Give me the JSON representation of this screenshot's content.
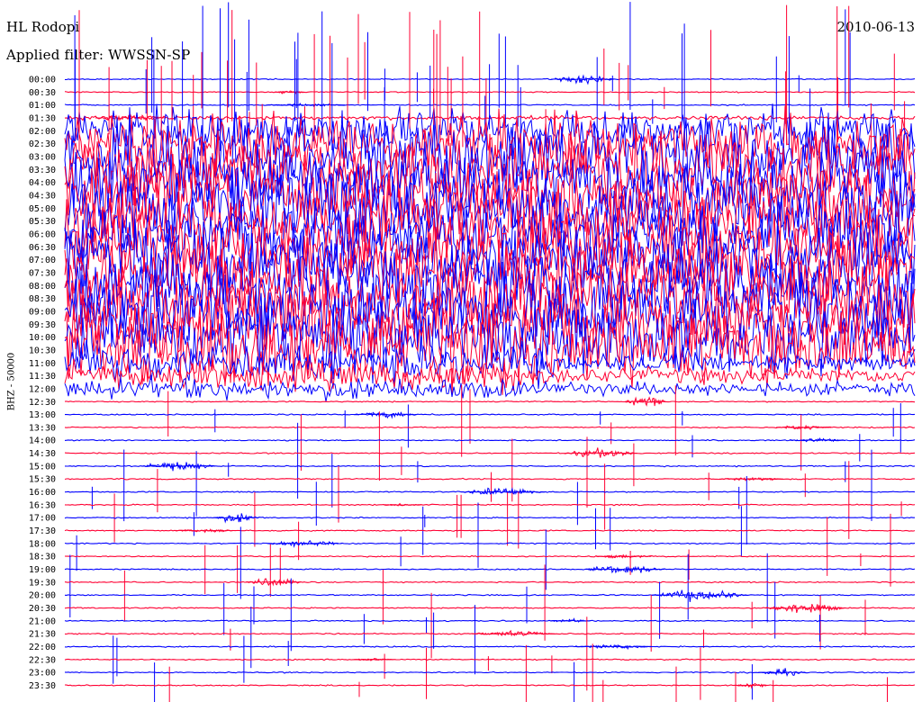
{
  "header": {
    "station": "HL Rodopi",
    "date": "2010-06-13",
    "filter": "Applied filter: WWSSN-SP",
    "channel": "BHZ - 50000"
  },
  "chart_data": {
    "type": "helicorder",
    "ylabel": "BHZ - 50000",
    "row_labels": [
      "00:00",
      "00:30",
      "01:00",
      "01:30",
      "02:00",
      "02:30",
      "03:00",
      "03:30",
      "04:00",
      "04:30",
      "05:00",
      "05:30",
      "06:00",
      "06:30",
      "07:00",
      "07:30",
      "08:00",
      "08:30",
      "09:00",
      "09:30",
      "10:00",
      "10:30",
      "11:00",
      "11:30",
      "12:00",
      "12:30",
      "13:00",
      "13:30",
      "14:00",
      "14:30",
      "15:00",
      "15:30",
      "16:00",
      "16:30",
      "17:00",
      "17:30",
      "18:00",
      "18:30",
      "19:00",
      "19:30",
      "20:00",
      "20:30",
      "21:00",
      "21:30",
      "22:00",
      "22:30",
      "23:00",
      "23:30"
    ],
    "series_colors": [
      "#0000ff",
      "#ff0033"
    ]
  }
}
